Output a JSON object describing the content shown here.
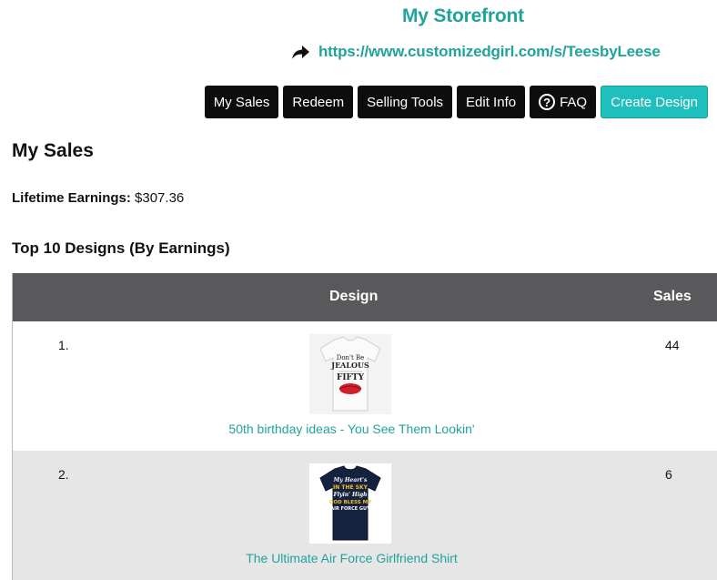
{
  "header": {
    "title": "My Storefront",
    "store_url": "https://www.customizedgirl.com/s/TeesbyLeese"
  },
  "nav": {
    "my_sales": "My Sales",
    "redeem": "Redeem",
    "selling_tools": "Selling Tools",
    "edit_info": "Edit Info",
    "faq": "FAQ",
    "create_design": "Create Design"
  },
  "page": {
    "section_title": "My Sales",
    "lifetime_label": "Lifetime Earnings:",
    "lifetime_value": "$307.36",
    "top_title": "Top 10 Designs (By Earnings)"
  },
  "table": {
    "columns": {
      "design": "Design",
      "sales": "Sales"
    },
    "rows": [
      {
        "rank": "1.",
        "design_name": "50th birthday ideas - You See Them Lookin'",
        "sales": "44",
        "shirt_text": [
          "Don't Be",
          "JEALOUS",
          "FIFTY"
        ]
      },
      {
        "rank": "2.",
        "design_name": "The Ultimate Air Force Girlfriend Shirt",
        "sales": "6",
        "shirt_text": [
          "My Heart's",
          "IN THE SKY",
          "Flyin' High",
          "GOD BLESS MY",
          "AIR FORCE GUY"
        ]
      }
    ]
  },
  "colors": {
    "accent": "#20a39a",
    "button_dark": "#0d0d0d",
    "button_primary": "#1fbfbd",
    "table_header": "#59595c",
    "row_alt": "#e6e6e6"
  }
}
